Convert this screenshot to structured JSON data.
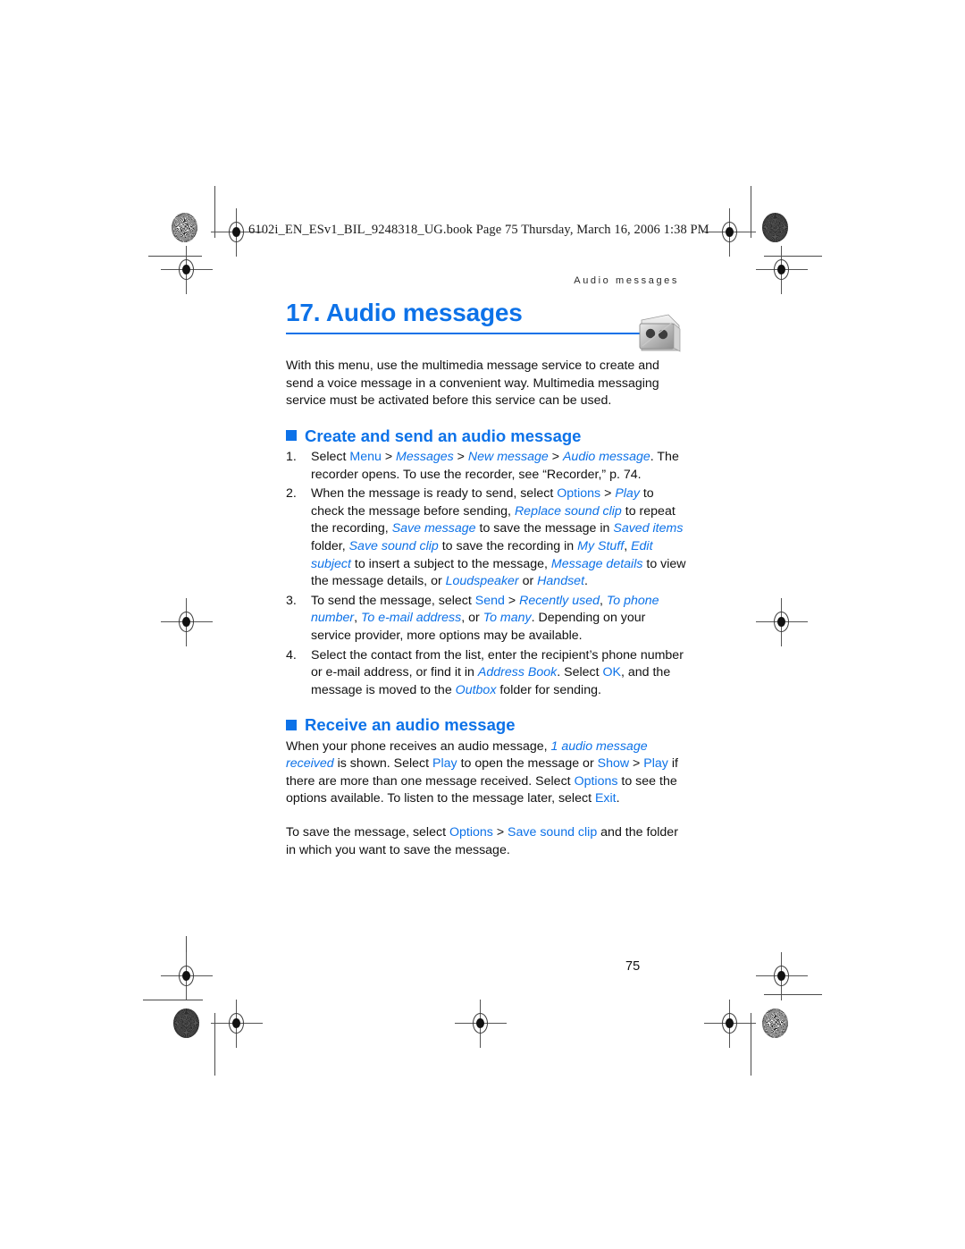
{
  "book_line": "6102i_EN_ESv1_BIL_9248318_UG.book  Page 75  Thursday, March 16, 2006  1:38 PM",
  "running_head": "Audio messages",
  "title": "17. Audio messages",
  "title_icon": "audio-message-envelope-icon",
  "accent_color": "#0d72e8",
  "page_number": "75",
  "intro": "With this menu, use the multimedia message service to create and send a voice message in a convenient way. Multimedia messaging service must be activated before this service can be used.",
  "sections": [
    {
      "heading": "Create and send an audio message",
      "steps": [
        {
          "number": "1.",
          "parts": [
            {
              "t": "Select ",
              "s": "n"
            },
            {
              "t": "Menu",
              "s": "b"
            },
            {
              "t": " > ",
              "s": "n"
            },
            {
              "t": "Messages",
              "s": "bi"
            },
            {
              "t": " > ",
              "s": "n"
            },
            {
              "t": "New message",
              "s": "bi"
            },
            {
              "t": " > ",
              "s": "n"
            },
            {
              "t": "Audio message",
              "s": "bi"
            },
            {
              "t": ". The recorder opens. To use the recorder, see “Recorder,” p. 74.",
              "s": "n"
            }
          ]
        },
        {
          "number": "2.",
          "parts": [
            {
              "t": "When the message is ready to send, select ",
              "s": "n"
            },
            {
              "t": "Options",
              "s": "b"
            },
            {
              "t": " > ",
              "s": "n"
            },
            {
              "t": "Play",
              "s": "bi"
            },
            {
              "t": " to check the message before sending, ",
              "s": "n"
            },
            {
              "t": "Replace sound clip",
              "s": "bi"
            },
            {
              "t": " to repeat the recording, ",
              "s": "n"
            },
            {
              "t": "Save message",
              "s": "bi"
            },
            {
              "t": " to save the message in ",
              "s": "n"
            },
            {
              "t": "Saved items",
              "s": "bi"
            },
            {
              "t": " folder, ",
              "s": "n"
            },
            {
              "t": "Save sound clip",
              "s": "bi"
            },
            {
              "t": " to save the recording in ",
              "s": "n"
            },
            {
              "t": "My Stuff",
              "s": "bi"
            },
            {
              "t": ", ",
              "s": "n"
            },
            {
              "t": "Edit subject",
              "s": "bi"
            },
            {
              "t": " to insert a subject to the message, ",
              "s": "n"
            },
            {
              "t": "Message details",
              "s": "bi"
            },
            {
              "t": " to view the message details, or ",
              "s": "n"
            },
            {
              "t": "Loudspeaker",
              "s": "bi"
            },
            {
              "t": " or ",
              "s": "n"
            },
            {
              "t": "Handset",
              "s": "bi"
            },
            {
              "t": ".",
              "s": "n"
            }
          ]
        },
        {
          "number": "3.",
          "parts": [
            {
              "t": "To send the message, select ",
              "s": "n"
            },
            {
              "t": "Send",
              "s": "b"
            },
            {
              "t": " > ",
              "s": "n"
            },
            {
              "t": "Recently used",
              "s": "bi"
            },
            {
              "t": ", ",
              "s": "n"
            },
            {
              "t": "To phone number",
              "s": "bi"
            },
            {
              "t": ", ",
              "s": "n"
            },
            {
              "t": "To e-mail address",
              "s": "bi"
            },
            {
              "t": ", or ",
              "s": "n"
            },
            {
              "t": "To many",
              "s": "bi"
            },
            {
              "t": ". Depending on your service provider, more options may be available.",
              "s": "n"
            }
          ]
        },
        {
          "number": "4.",
          "parts": [
            {
              "t": "Select the contact from the list, enter the recipient’s phone number or e-mail address, or find it in ",
              "s": "n"
            },
            {
              "t": "Address Book",
              "s": "bi"
            },
            {
              "t": ". Select ",
              "s": "n"
            },
            {
              "t": "OK",
              "s": "b"
            },
            {
              "t": ", and the message is moved to the ",
              "s": "n"
            },
            {
              "t": "Outbox",
              "s": "bi"
            },
            {
              "t": " folder for sending.",
              "s": "n"
            }
          ]
        }
      ]
    },
    {
      "heading": "Receive an audio message",
      "paragraphs": [
        [
          {
            "t": "When your phone receives an audio message, ",
            "s": "n"
          },
          {
            "t": "1 audio message received",
            "s": "bi"
          },
          {
            "t": " is shown. Select ",
            "s": "n"
          },
          {
            "t": "Play",
            "s": "b"
          },
          {
            "t": " to open the message or ",
            "s": "n"
          },
          {
            "t": "Show",
            "s": "b"
          },
          {
            "t": " > ",
            "s": "n"
          },
          {
            "t": "Play",
            "s": "b"
          },
          {
            "t": " if there are more than one message received. Select ",
            "s": "n"
          },
          {
            "t": "Options",
            "s": "b"
          },
          {
            "t": " to see the options available. To listen to the message later, select ",
            "s": "n"
          },
          {
            "t": "Exit",
            "s": "b"
          },
          {
            "t": ".",
            "s": "n"
          }
        ],
        [
          {
            "t": "To save the message, select ",
            "s": "n"
          },
          {
            "t": "Options",
            "s": "b"
          },
          {
            "t": " > ",
            "s": "n"
          },
          {
            "t": "Save sound clip",
            "s": "b"
          },
          {
            "t": " and the folder in which you want to save the message.",
            "s": "n"
          }
        ]
      ]
    }
  ]
}
